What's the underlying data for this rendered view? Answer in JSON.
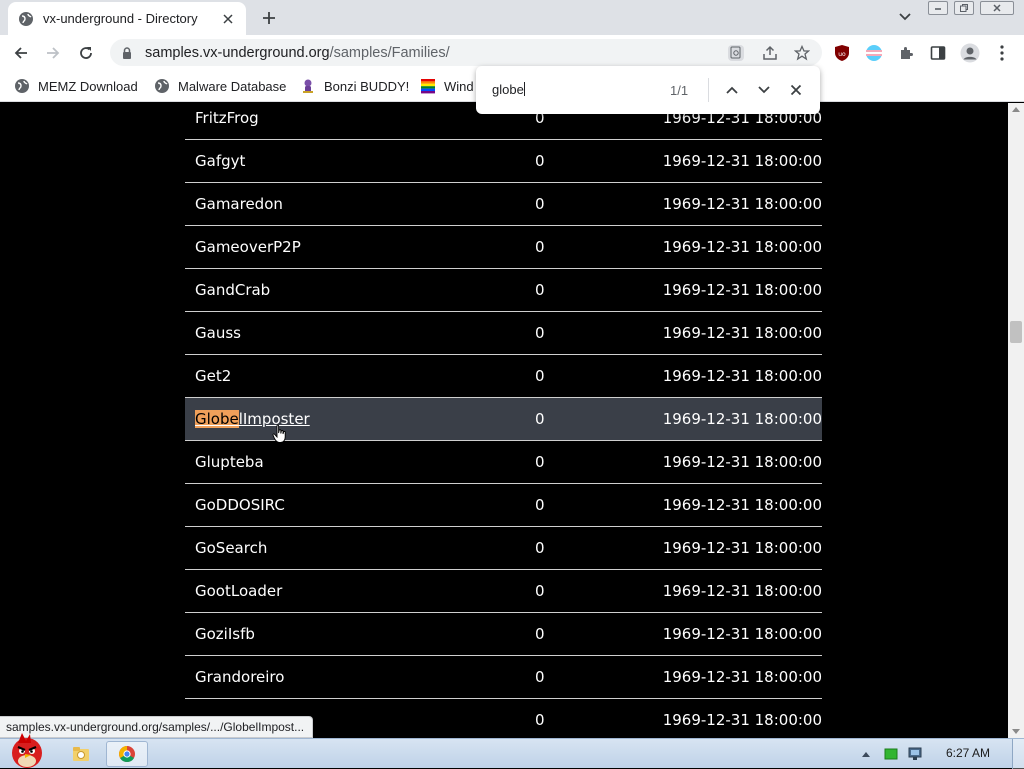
{
  "browser": {
    "tab_title": "vx-underground - Directory",
    "url_host": "samples.vx-underground.org",
    "url_path": "/samples/Families/",
    "bookmarks": [
      {
        "label": "MEMZ Download",
        "icon": "globe-icon"
      },
      {
        "label": "Malware Database",
        "icon": "globe-icon"
      },
      {
        "label": "Bonzi BUDDY!",
        "icon": "bonzi-icon"
      },
      {
        "label": "Wind",
        "icon": "windows-flag-icon"
      }
    ]
  },
  "find": {
    "query": "globe",
    "count": "1/1"
  },
  "listing": {
    "rows": [
      {
        "name": "FritzFrog",
        "size": "0",
        "date": "1969-12-31 18:00:00"
      },
      {
        "name": "Gafgyt",
        "size": "0",
        "date": "1969-12-31 18:00:00"
      },
      {
        "name": "Gamaredon",
        "size": "0",
        "date": "1969-12-31 18:00:00"
      },
      {
        "name": "GameoverP2P",
        "size": "0",
        "date": "1969-12-31 18:00:00"
      },
      {
        "name": "GandCrab",
        "size": "0",
        "date": "1969-12-31 18:00:00"
      },
      {
        "name": "Gauss",
        "size": "0",
        "date": "1969-12-31 18:00:00"
      },
      {
        "name": "Get2",
        "size": "0",
        "date": "1969-12-31 18:00:00"
      },
      {
        "name": "GlobelImposter",
        "size": "0",
        "date": "1969-12-31 18:00:00",
        "match": "Globe",
        "rest": "lImposter",
        "hover": true
      },
      {
        "name": "Glupteba",
        "size": "0",
        "date": "1969-12-31 18:00:00"
      },
      {
        "name": "GoDDOSIRC",
        "size": "0",
        "date": "1969-12-31 18:00:00"
      },
      {
        "name": "GoSearch",
        "size": "0",
        "date": "1969-12-31 18:00:00"
      },
      {
        "name": "GootLoader",
        "size": "0",
        "date": "1969-12-31 18:00:00"
      },
      {
        "name": "GoziIsfb",
        "size": "0",
        "date": "1969-12-31 18:00:00"
      },
      {
        "name": "Grandoreiro",
        "size": "0",
        "date": "1969-12-31 18:00:00"
      },
      {
        "name": "",
        "size": "0",
        "date": "1969-12-31 18:00:00"
      }
    ]
  },
  "status_url": "samples.vx-underground.org/samples/.../GlobelImpost...",
  "taskbar": {
    "clock": "6:27 AM"
  },
  "colors": {
    "find_highlight": "#f0a05a",
    "page_background": "#000000",
    "row_hover": "#3a3f48"
  }
}
